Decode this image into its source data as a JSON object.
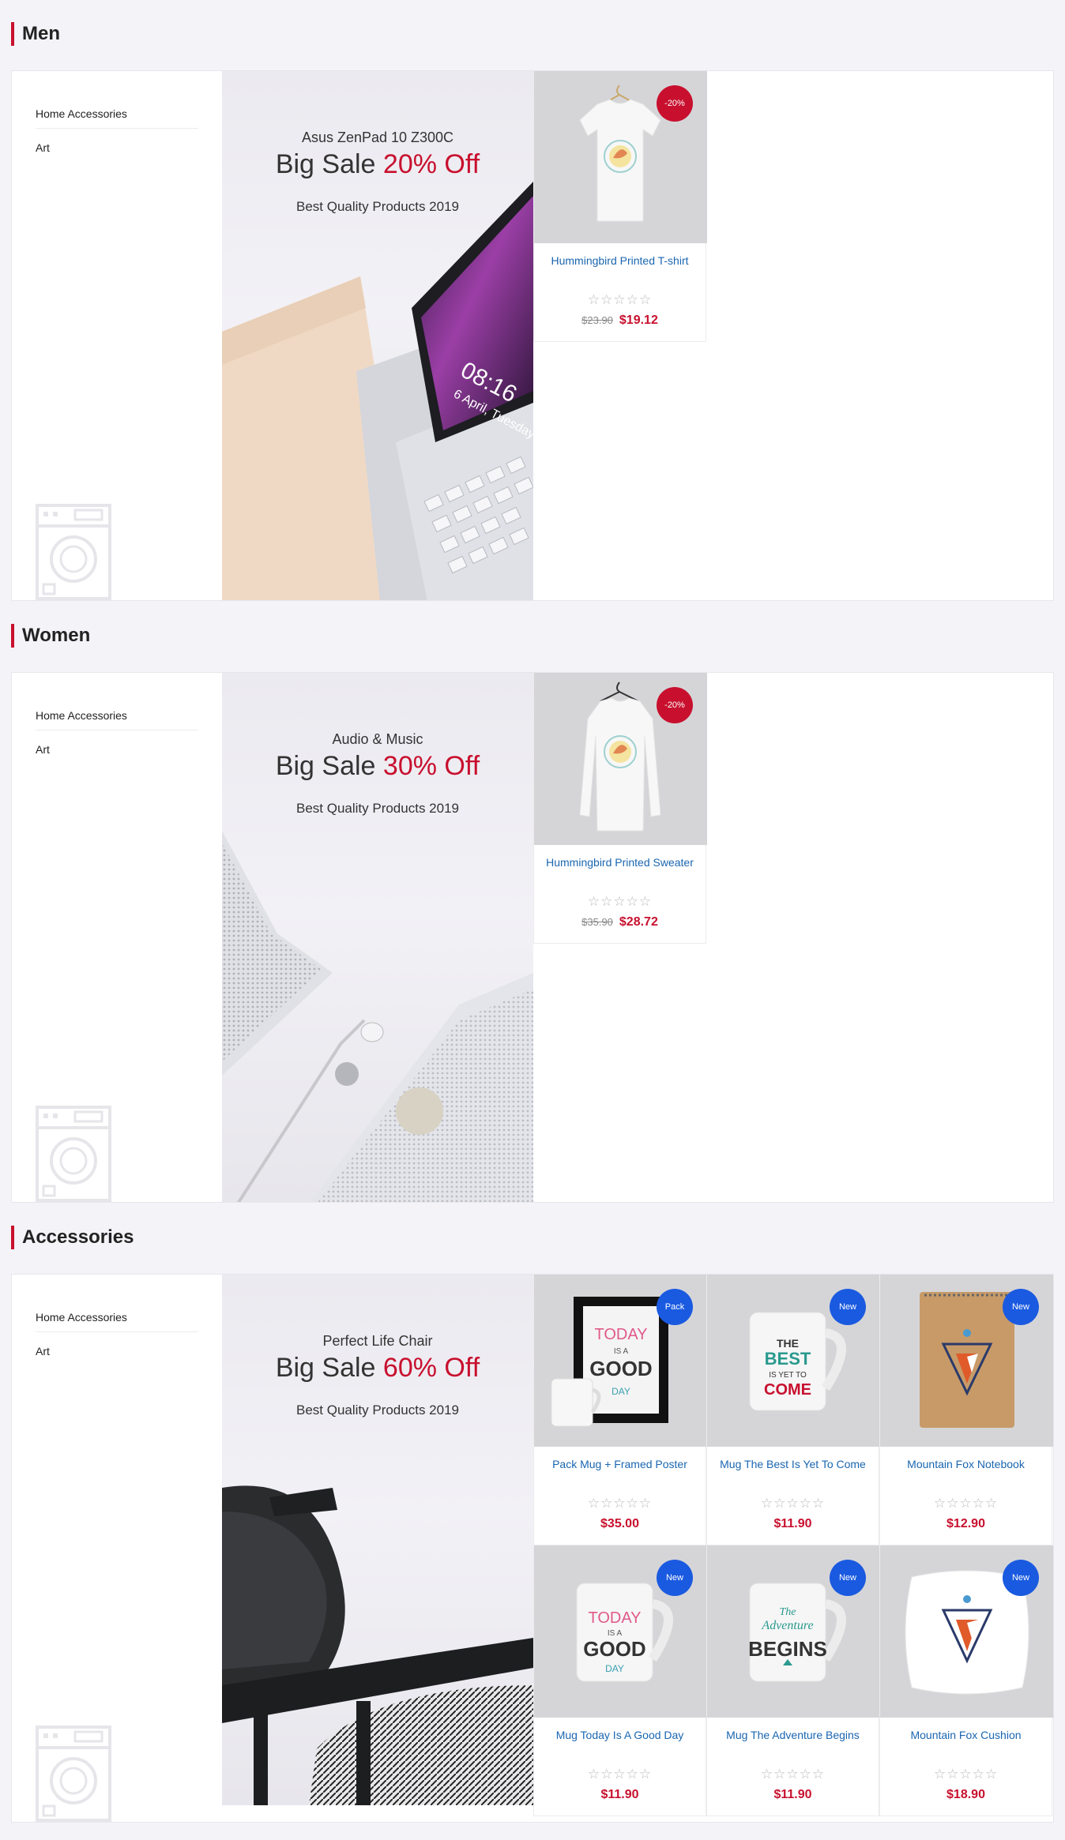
{
  "categories": [
    "Home Accessories",
    "Art"
  ],
  "sections": [
    {
      "title": "Men",
      "banner": {
        "sub": "Asus ZenPad 10 Z300C",
        "big_prefix": "Big Sale ",
        "big_highlight": "20% Off",
        "quality": "Best Quality Products 2019",
        "clock_time": "08:16",
        "clock_date": "6 April, Tuesday"
      },
      "products": [
        {
          "name": "Hummingbird Printed T-shirt",
          "old_price": "$23.90",
          "price": "$19.12",
          "badge": "-20%",
          "badge_type": "sale",
          "icon": "tshirt-icon"
        }
      ]
    },
    {
      "title": "Women",
      "banner": {
        "sub": "Audio & Music",
        "big_prefix": "Big Sale ",
        "big_highlight": "30% Off",
        "quality": "Best Quality Products 2019"
      },
      "products": [
        {
          "name": "Hummingbird Printed Sweater",
          "old_price": "$35.90",
          "price": "$28.72",
          "badge": "-20%",
          "badge_type": "sale",
          "icon": "sweater-icon"
        }
      ]
    },
    {
      "title": "Accessories",
      "banner": {
        "sub": "Perfect Life Chair",
        "big_prefix": "Big Sale ",
        "big_highlight": "60% Off",
        "quality": "Best Quality Products 2019"
      },
      "products": [
        {
          "name": "Pack Mug + Framed Poster",
          "old_price": "",
          "price": "$35.00",
          "badge": "Pack",
          "badge_type": "new",
          "icon": "poster-icon",
          "art_top": "TODAY",
          "art_mid": "IS A",
          "art_big": "GOOD",
          "art_bot": "DAY"
        },
        {
          "name": "Mug The Best Is Yet To Come",
          "old_price": "",
          "price": "$11.90",
          "badge": "New",
          "badge_type": "new",
          "icon": "mug-icon",
          "art_top": "THE",
          "art_mid": "BEST",
          "art_big": "IS YET TO",
          "art_bot": "COME"
        },
        {
          "name": "Mountain Fox Notebook",
          "old_price": "",
          "price": "$12.90",
          "badge": "New",
          "badge_type": "new",
          "icon": "notebook-icon"
        },
        {
          "name": "Mug Today Is A Good Day",
          "old_price": "",
          "price": "$11.90",
          "badge": "New",
          "badge_type": "new",
          "icon": "mug-icon",
          "art_top": "TODAY",
          "art_mid": "IS A",
          "art_big": "GOOD",
          "art_bot": "DAY"
        },
        {
          "name": "Mug The Adventure Begins",
          "old_price": "",
          "price": "$11.90",
          "badge": "New",
          "badge_type": "new",
          "icon": "mug-icon",
          "art_top": "The",
          "art_mid": "Adventure",
          "art_big": "BEGINS",
          "art_bot": ""
        },
        {
          "name": "Mountain Fox Cushion",
          "old_price": "",
          "price": "$18.90",
          "badge": "New",
          "badge_type": "new",
          "icon": "cushion-icon"
        }
      ]
    }
  ],
  "stars": "☆☆☆☆☆",
  "colors": {
    "accent": "#c8102e",
    "link": "#1a66b0",
    "new_badge": "#1a5ae0"
  }
}
